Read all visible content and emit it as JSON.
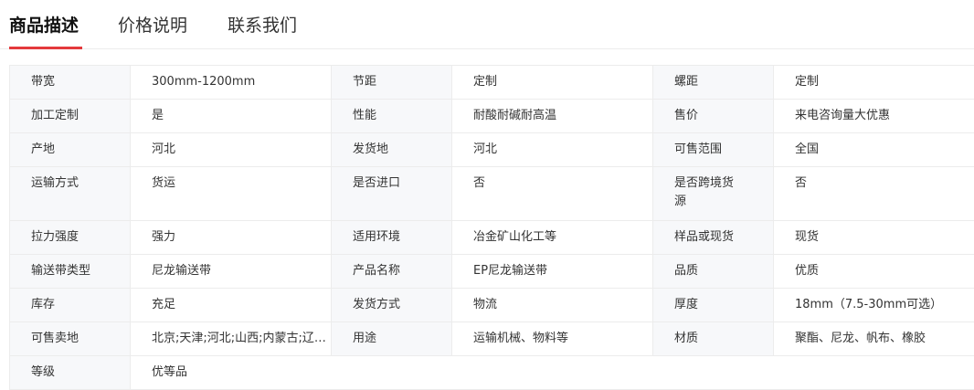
{
  "tabs": [
    {
      "label": "商品描述",
      "active": true
    },
    {
      "label": "价格说明",
      "active": false
    },
    {
      "label": "联系我们",
      "active": false
    }
  ],
  "attributes": [
    [
      {
        "key": "带宽",
        "value": "300mm-1200mm"
      },
      {
        "key": "节距",
        "value": "定制"
      },
      {
        "key": "螺距",
        "value": "定制"
      }
    ],
    [
      {
        "key": "加工定制",
        "value": "是"
      },
      {
        "key": "性能",
        "value": "耐酸耐碱耐高温"
      },
      {
        "key": "售价",
        "value": "来电咨询量大优惠"
      }
    ],
    [
      {
        "key": "产地",
        "value": "河北"
      },
      {
        "key": "发货地",
        "value": "河北"
      },
      {
        "key": "可售范围",
        "value": "全国"
      }
    ],
    [
      {
        "key": "运输方式",
        "value": "货运"
      },
      {
        "key": "是否进口",
        "value": "否"
      },
      {
        "key": "是否跨境货源",
        "value": "否"
      }
    ],
    [
      {
        "key": "拉力强度",
        "value": "强力"
      },
      {
        "key": "适用环境",
        "value": "冶金矿山化工等"
      },
      {
        "key": "样品或现货",
        "value": "现货"
      }
    ],
    [
      {
        "key": "输送带类型",
        "value": "尼龙输送带"
      },
      {
        "key": "产品名称",
        "value": "EP尼龙输送带"
      },
      {
        "key": "品质",
        "value": "优质"
      }
    ],
    [
      {
        "key": "库存",
        "value": "充足"
      },
      {
        "key": "发货方式",
        "value": "物流"
      },
      {
        "key": "厚度",
        "value": "18mm（7.5-30mm可选）"
      }
    ],
    [
      {
        "key": "可售卖地",
        "value": "北京;天津;河北;山西;内蒙古;辽宁;吉林;黑龙江;上海;江苏;浙江;安徽;福建;江西;山东;河南;湖北;湖南;广东;广西;海南;重庆;四川;贵州;云南;西藏;陕西;甘肃;青海;宁夏;新疆"
      },
      {
        "key": "用途",
        "value": "运输机械、物料等"
      },
      {
        "key": "材质",
        "value": "聚酯、尼龙、帆布、橡胶"
      }
    ],
    [
      {
        "key": "等级",
        "value": "优等品"
      }
    ]
  ],
  "colors": {
    "accent": "#e4393c",
    "key_bg": "#f7f8fa",
    "border": "#ececec"
  }
}
